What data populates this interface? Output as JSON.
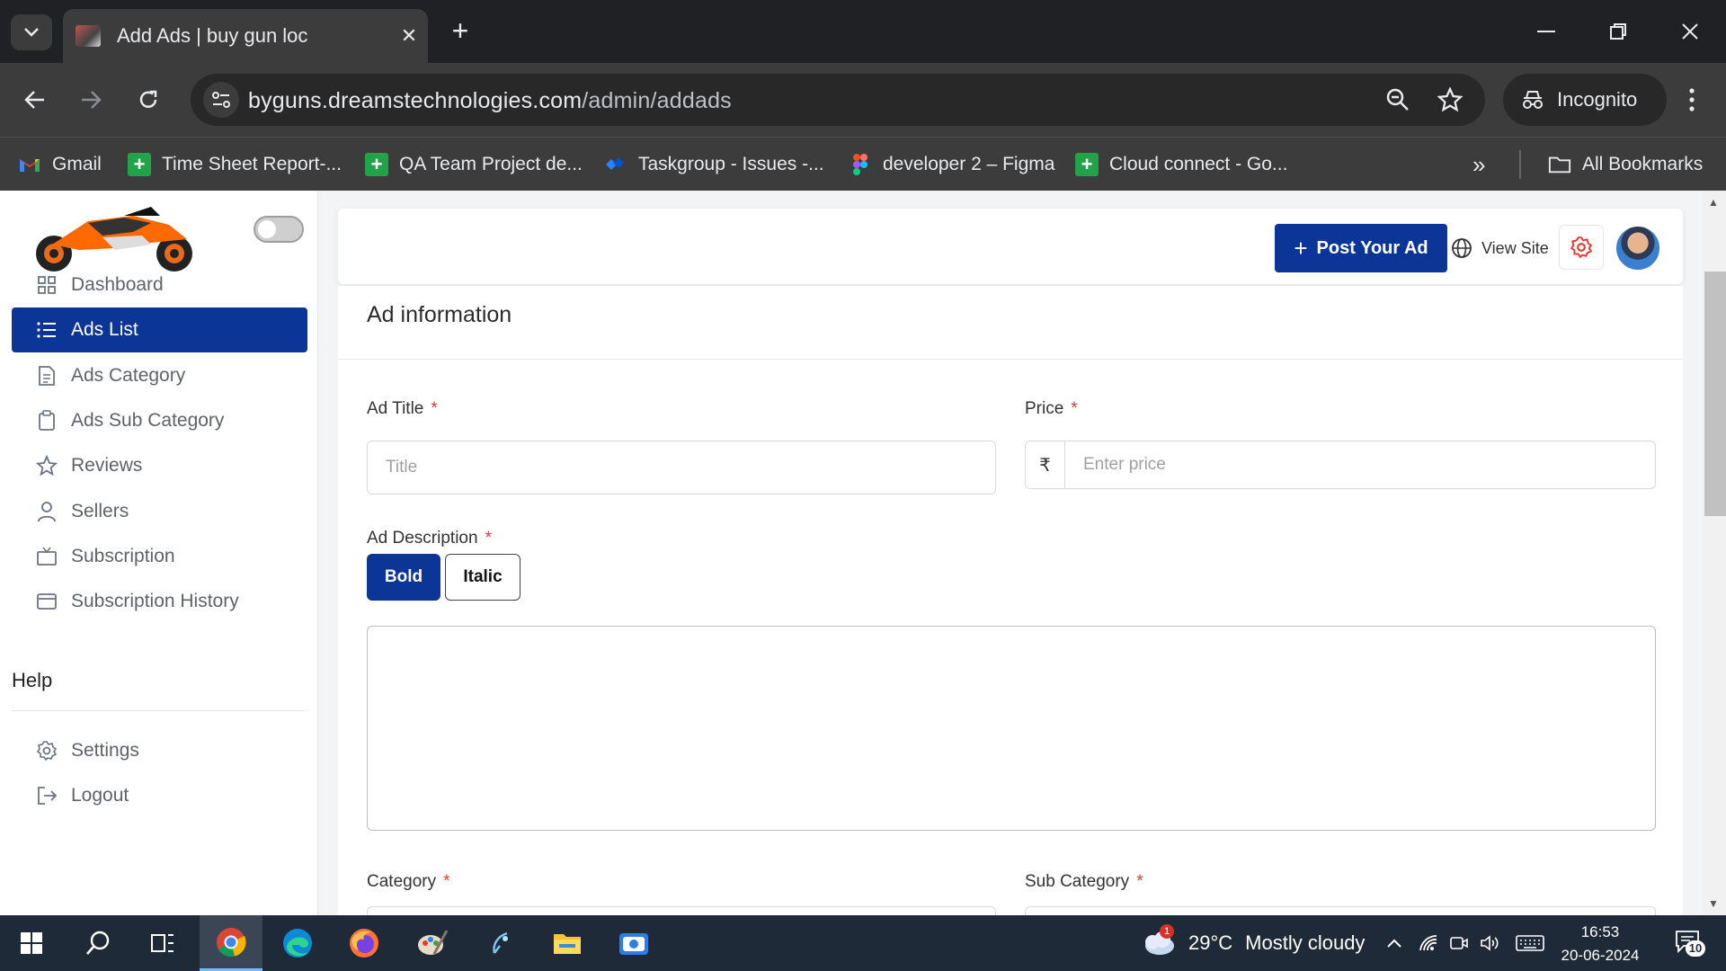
{
  "browser": {
    "tab_title": "Add Ads | buy gun loc",
    "url_domain": "byguns.dreamstechnologies.com",
    "url_path": "/admin/addads",
    "incognito_label": "Incognito",
    "bookmarks": [
      {
        "label": "Gmail",
        "icon": "gmail-icon"
      },
      {
        "label": "Time Sheet Report-...",
        "icon": "sheets-icon"
      },
      {
        "label": "QA Team Project de...",
        "icon": "sheets-icon"
      },
      {
        "label": "Taskgroup - Issues -...",
        "icon": "jira-icon"
      },
      {
        "label": "developer 2 – Figma",
        "icon": "figma-icon"
      },
      {
        "label": "Cloud connect - Go...",
        "icon": "sheets-icon"
      }
    ],
    "all_bookmarks_label": "All Bookmarks"
  },
  "sidebar": {
    "items": [
      {
        "label": "Dashboard",
        "icon": "grid-icon"
      },
      {
        "label": "Ads List",
        "icon": "list-icon",
        "active": true
      },
      {
        "label": "Ads Category",
        "icon": "document-icon"
      },
      {
        "label": "Ads Sub Category",
        "icon": "clipboard-icon"
      },
      {
        "label": "Reviews",
        "icon": "star-icon"
      },
      {
        "label": "Sellers",
        "icon": "user-icon"
      },
      {
        "label": "Subscription",
        "icon": "tv-icon"
      },
      {
        "label": "Subscription History",
        "icon": "card-icon"
      }
    ],
    "help_heading": "Help",
    "help_items": [
      {
        "label": "Settings",
        "icon": "gear-icon"
      },
      {
        "label": "Logout",
        "icon": "logout-icon"
      }
    ]
  },
  "header": {
    "post_ad_label": "Post Your Ad",
    "view_site_label": "View Site"
  },
  "form": {
    "section_title": "Ad information",
    "ad_title_label": "Ad Title",
    "ad_title_placeholder": "Title",
    "price_label": "Price",
    "currency_symbol": "₹",
    "price_placeholder": "Enter price",
    "description_label": "Ad Description",
    "bold_label": "Bold",
    "italic_label": "Italic",
    "category_label": "Category",
    "subcategory_label": "Sub Category",
    "required_mark": "*"
  },
  "taskbar": {
    "weather_temp": "29°C",
    "weather_text": "Mostly cloudy",
    "weather_badge": "1",
    "time": "16:53",
    "date": "20-06-2024",
    "notification_count": "10"
  },
  "colors": {
    "primary": "#0b3597",
    "required": "#e53935",
    "accent_red": "#e53935"
  }
}
